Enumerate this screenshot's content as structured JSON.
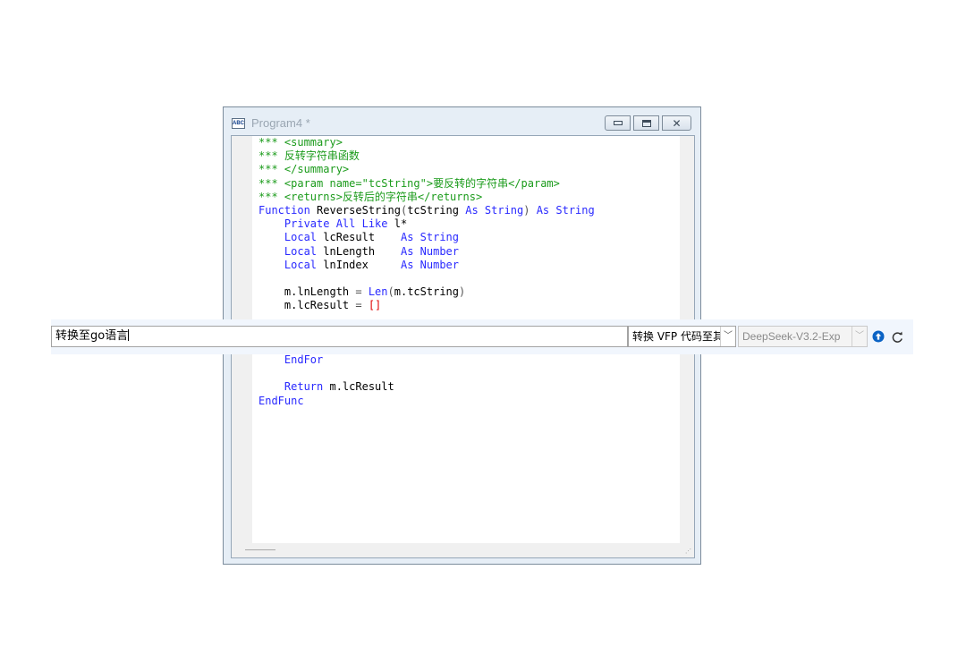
{
  "window": {
    "title": "Program4 *",
    "app_icon_text": "ABC"
  },
  "code_lines": [
    [
      {
        "c": "c",
        "t": "*** <summary>"
      }
    ],
    [
      {
        "c": "c",
        "t": "*** 反转字符串函数"
      }
    ],
    [
      {
        "c": "c",
        "t": "*** </summary>"
      }
    ],
    [
      {
        "c": "c",
        "t": "*** <param name=\"tcString\">要反转的字符串</param>"
      }
    ],
    [
      {
        "c": "c",
        "t": "*** <returns>反转后的字符串</returns>"
      }
    ],
    [
      {
        "c": "k",
        "t": "Function "
      },
      {
        "c": "t",
        "t": "ReverseString"
      },
      {
        "c": "p",
        "t": "("
      },
      {
        "c": "t",
        "t": "tcString "
      },
      {
        "c": "k",
        "t": "As String"
      },
      {
        "c": "p",
        "t": ") "
      },
      {
        "c": "k",
        "t": "As String"
      }
    ],
    [
      {
        "c": "t",
        "t": "    "
      },
      {
        "c": "k",
        "t": "Private All Like "
      },
      {
        "c": "t",
        "t": "l*"
      }
    ],
    [
      {
        "c": "t",
        "t": "    "
      },
      {
        "c": "k",
        "t": "Local "
      },
      {
        "c": "t",
        "t": "lcResult    "
      },
      {
        "c": "k",
        "t": "As String"
      }
    ],
    [
      {
        "c": "t",
        "t": "    "
      },
      {
        "c": "k",
        "t": "Local "
      },
      {
        "c": "t",
        "t": "lnLength    "
      },
      {
        "c": "k",
        "t": "As Number"
      }
    ],
    [
      {
        "c": "t",
        "t": "    "
      },
      {
        "c": "k",
        "t": "Local "
      },
      {
        "c": "t",
        "t": "lnIndex     "
      },
      {
        "c": "k",
        "t": "As Number"
      }
    ],
    [],
    [
      {
        "c": "t",
        "t": "    m.lnLength "
      },
      {
        "c": "p",
        "t": "= "
      },
      {
        "c": "k",
        "t": "Len"
      },
      {
        "c": "p",
        "t": "("
      },
      {
        "c": "t",
        "t": "m.tcString"
      },
      {
        "c": "p",
        "t": ")"
      }
    ],
    [
      {
        "c": "t",
        "t": "    m.lcResult "
      },
      {
        "c": "p",
        "t": "= "
      },
      {
        "c": "r",
        "t": "[]"
      }
    ],
    [],
    [],
    [],
    [
      {
        "c": "t",
        "t": "    "
      },
      {
        "c": "k",
        "t": "EndFor"
      }
    ],
    [],
    [
      {
        "c": "t",
        "t": "    "
      },
      {
        "c": "k",
        "t": "Return "
      },
      {
        "c": "t",
        "t": "m.lcResult"
      }
    ],
    [
      {
        "c": "k",
        "t": "EndFunc"
      }
    ]
  ],
  "prompt": {
    "input_value": "转换至go语言",
    "action_select": "转换 VFP 代码至其",
    "model_select": "DeepSeek-V3.2-Exp",
    "dropdown_arrow": "﹀",
    "send_icon": "arrow-up-circle-icon",
    "undo_icon": "redo-arrow-icon"
  },
  "colors": {
    "comment": "#1b9b1b",
    "keyword": "#2929ff",
    "string_literal": "#e00000",
    "send_icon": "#0b63c5"
  }
}
